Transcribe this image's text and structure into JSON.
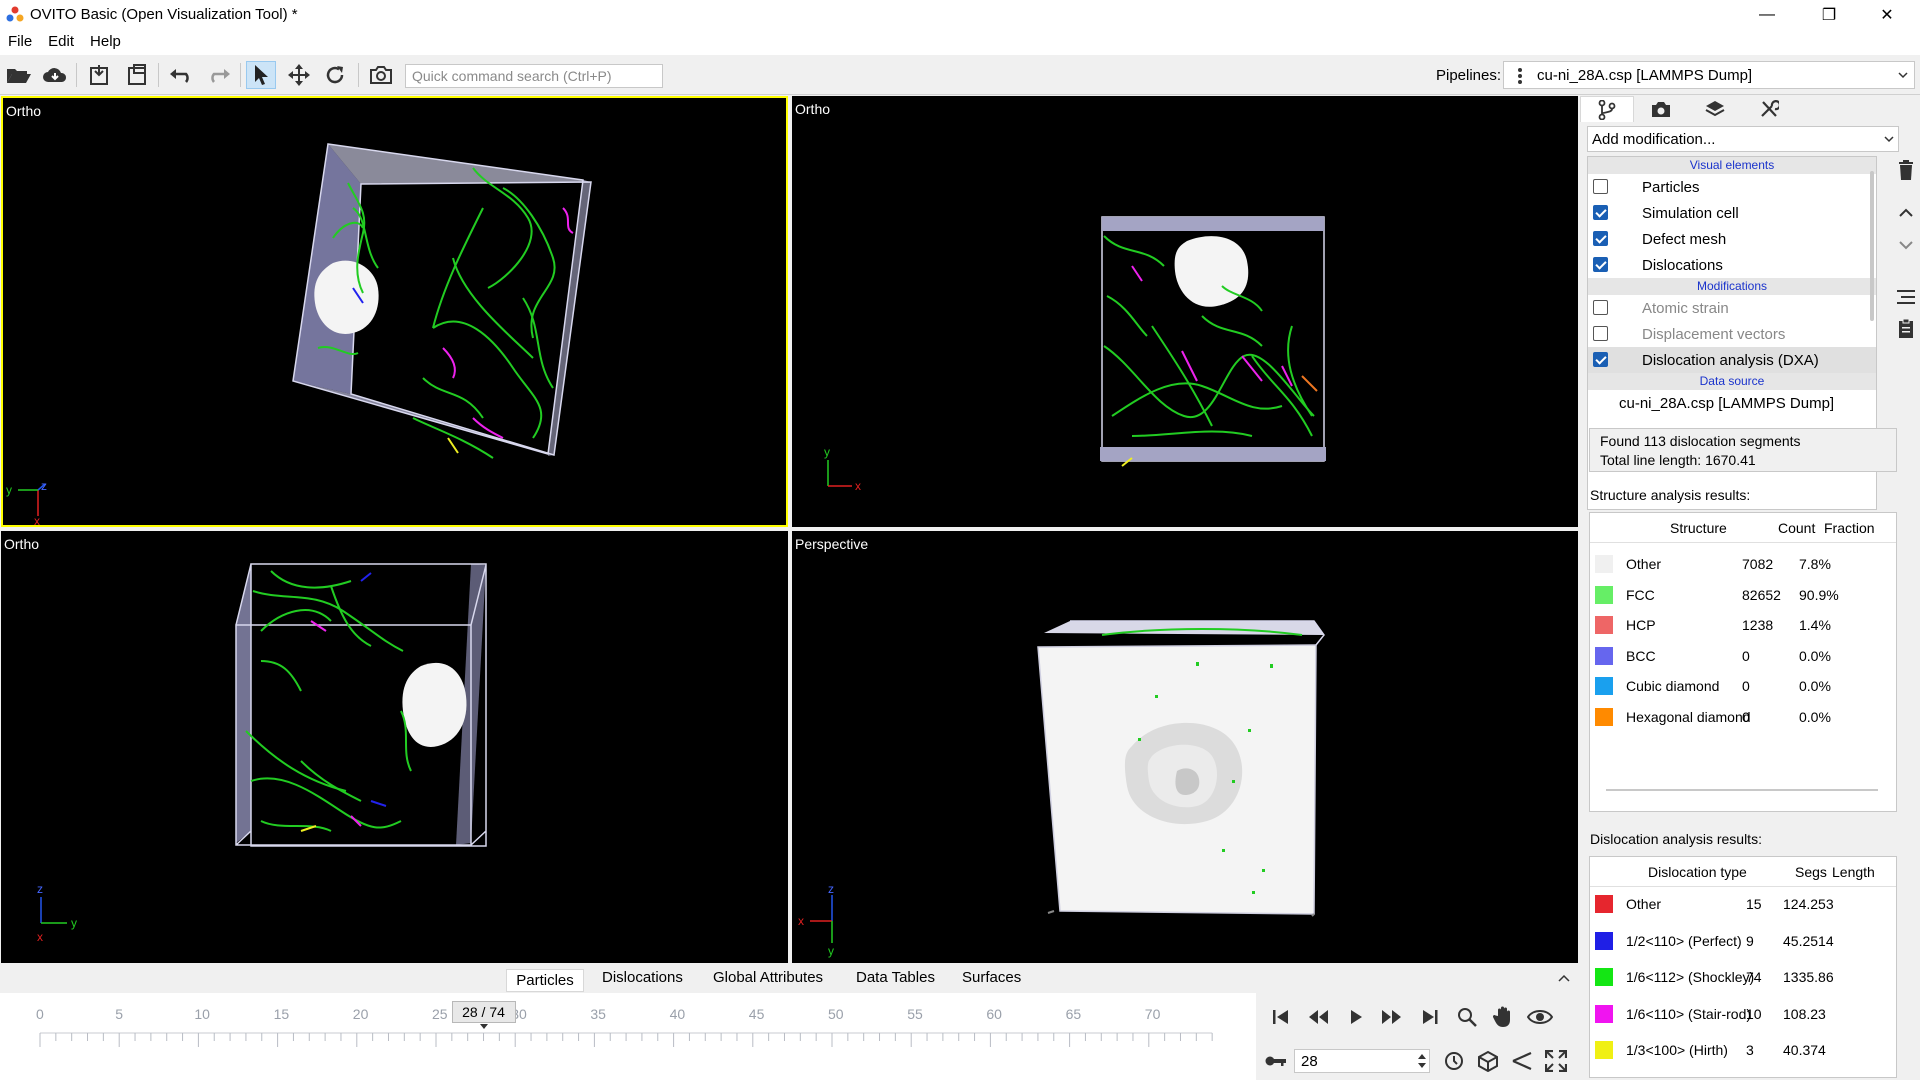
{
  "window": {
    "title": "OVITO Basic (Open Visualization Tool) *",
    "minimize": "—",
    "maximize": "❐",
    "close": "✕"
  },
  "menu": [
    "File",
    "Edit",
    "Help"
  ],
  "toolbar": {
    "search_placeholder": "Quick command search (Ctrl+P)",
    "pipelines_label": "Pipelines:",
    "pipeline_value": "cu-ni_28A.csp [LAMMPS Dump]"
  },
  "viewports": [
    {
      "caption": "Ortho",
      "axes": [
        "y",
        "z",
        "x"
      ]
    },
    {
      "caption": "Ortho",
      "axes": [
        "y",
        "x"
      ]
    },
    {
      "caption": "Ortho",
      "axes": [
        "z",
        "y",
        "x"
      ]
    },
    {
      "caption": "Perspective",
      "axes": [
        "z",
        "x",
        "y"
      ]
    }
  ],
  "panel": {
    "add_modification": "Add modification...",
    "sections": {
      "visual": "Visual elements",
      "mods": "Modifications",
      "source": "Data source"
    },
    "visual_elements": [
      {
        "label": "Particles",
        "checked": false
      },
      {
        "label": "Simulation cell",
        "checked": true
      },
      {
        "label": "Defect mesh",
        "checked": true
      },
      {
        "label": "Dislocations",
        "checked": true
      }
    ],
    "modifications": [
      {
        "label": "Atomic strain",
        "checked": false
      },
      {
        "label": "Displacement vectors",
        "checked": false
      },
      {
        "label": "Dislocation analysis (DXA)",
        "checked": true
      }
    ],
    "data_source": "cu-ni_28A.csp [LAMMPS Dump]",
    "summary_line1": "Found 113 dislocation segments",
    "summary_line2": "Total line length: 1670.41",
    "struct_title": "Structure analysis results:",
    "struct_headers": {
      "structure": "Structure",
      "count": "Count",
      "fraction": "Fraction"
    },
    "structures": [
      {
        "name": "Other",
        "count": "7082",
        "fraction": "7.8%",
        "color": "#f0f0f0"
      },
      {
        "name": "FCC",
        "count": "82652",
        "fraction": "90.9%",
        "color": "#66ee66"
      },
      {
        "name": "HCP",
        "count": "1238",
        "fraction": "1.4%",
        "color": "#ee6666"
      },
      {
        "name": "BCC",
        "count": "0",
        "fraction": "0.0%",
        "color": "#6666ee"
      },
      {
        "name": "Cubic diamond",
        "count": "0",
        "fraction": "0.0%",
        "color": "#1aa0ee"
      },
      {
        "name": "Hexagonal diamond",
        "count": "0",
        "fraction": "0.0%",
        "color": "#ff8a00"
      }
    ],
    "disl_title": "Dislocation analysis results:",
    "disl_headers": {
      "type": "Dislocation type",
      "segs": "Segs",
      "length": "Length"
    },
    "dislocations": [
      {
        "name": "Other",
        "segs": "15",
        "length": "124.253",
        "color": "#e6262e"
      },
      {
        "name": "1/2<110> (Perfect)",
        "segs": "9",
        "length": "45.2514",
        "color": "#1f1fe6"
      },
      {
        "name": "1/6<112> (Shockley)",
        "segs": "74",
        "length": "1335.86",
        "color": "#14e614"
      },
      {
        "name": "1/6<110> (Stair-rod)",
        "segs": "10",
        "length": "108.23",
        "color": "#f014f0"
      },
      {
        "name": "1/3<100> (Hirth)",
        "segs": "3",
        "length": "40.374",
        "color": "#f0f014"
      }
    ]
  },
  "bottom_tabs": [
    "Particles",
    "Dislocations",
    "Global Attributes",
    "Data Tables",
    "Surfaces"
  ],
  "timeline": {
    "ticks": [
      "0",
      "5",
      "10",
      "15",
      "20",
      "25",
      "30",
      "35",
      "40",
      "45",
      "50",
      "55",
      "60",
      "65",
      "70"
    ],
    "current_label": "28 / 74",
    "current_frame": 28,
    "total_frames": 74
  },
  "animation": {
    "frame_value": "28"
  }
}
